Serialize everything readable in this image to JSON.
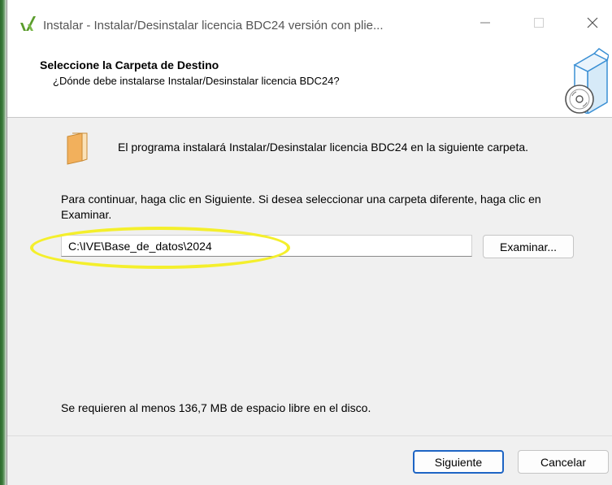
{
  "window": {
    "title": "Instalar - Instalar/Desinstalar licencia BDC24 versión con plie..."
  },
  "header": {
    "title": "Seleccione la Carpeta de Destino",
    "subtitle": "¿Dónde debe instalarse Instalar/Desinstalar licencia BDC24?"
  },
  "content": {
    "intro": "El programa instalará Instalar/Desinstalar licencia BDC24 en la siguiente carpeta.",
    "instructions": "Para continuar, haga clic en Siguiente. Si desea seleccionar una carpeta diferente, haga clic en Examinar.",
    "path_value": "C:\\IVE\\Base_de_datos\\2024",
    "browse_label": "Examinar...",
    "space_required": "Se requieren al menos 136,7 MB de espacio libre en el disco."
  },
  "footer": {
    "next_label": "Siguiente",
    "cancel_label": "Cancelar"
  },
  "colors": {
    "accent": "#1d64c4",
    "highlight": "#f4ef2c",
    "folder": "#f2b05c",
    "logo": "#5a9c2c"
  },
  "icons": {
    "app": "installer-logo-icon",
    "header": "software-box-cd-icon",
    "folder": "folder-icon"
  }
}
